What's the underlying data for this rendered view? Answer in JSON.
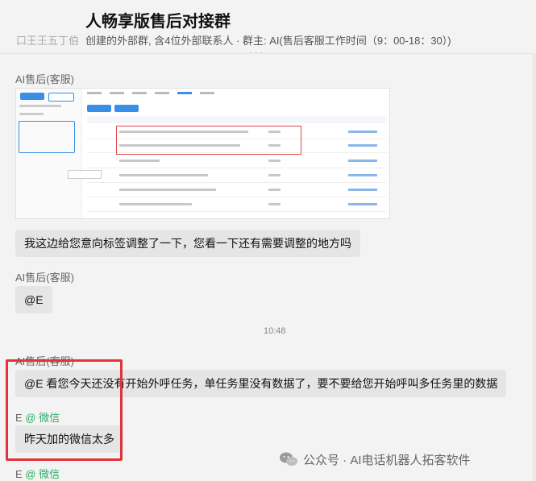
{
  "header": {
    "title": "人畅享版售后对接群",
    "subtitle": "创建的外部群, 含4位外部联系人 · 群主: AI(售后客服工作时间（9：00-18：30）)",
    "ghost_left": "口王王五丁伯"
  },
  "messages": [
    {
      "sender": "AI售后(客服)"
    },
    {
      "sender": "AI售后(客服)",
      "text": "我这边给您意向标签调整了一下，您看一下还有需要调整的地方吗"
    },
    {
      "sender": "AI售后(客服)",
      "text": "@E"
    },
    {
      "sender": "AI售后(客服)",
      "text": "@E 看您今天还没有开始外呼任务，单任务里没有数据了，要不要给您开始呼叫多任务里的数据"
    },
    {
      "sender": "E",
      "source": "@ 微信",
      "text": "昨天加的微信太多"
    },
    {
      "sender": "E",
      "source": "@ 微信"
    }
  ],
  "timestamp": "10:48",
  "watermark": "公众号 · AI电话机器人拓客软件",
  "colors": {
    "background": "#f3f3f3",
    "bubble": "#e5e5e5",
    "wechat_source": "#2aae67",
    "highlight_border": "#e0333a"
  }
}
